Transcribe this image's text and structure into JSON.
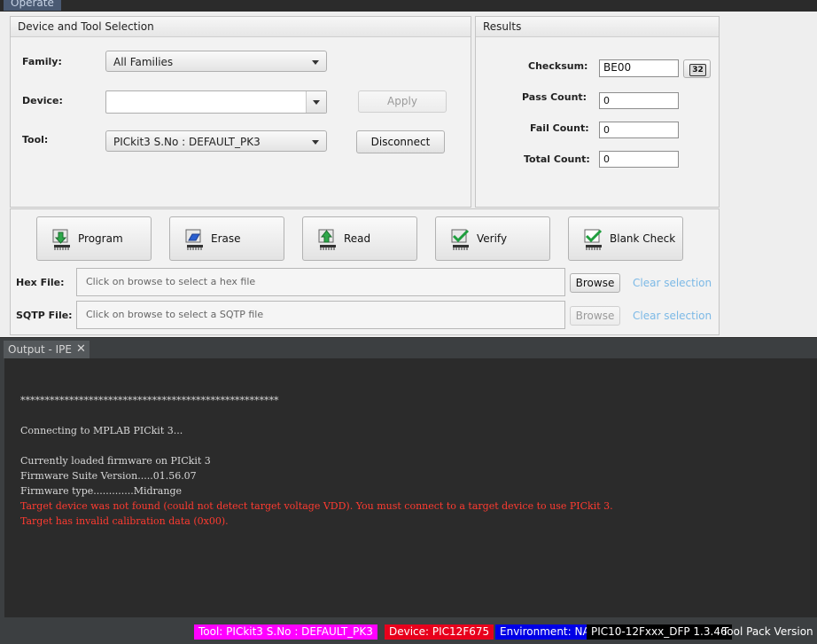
{
  "top": {
    "tab_label": "Operate"
  },
  "device_panel": {
    "title": "Device and Tool Selection",
    "family_label": "Family:",
    "family_value": "All Families",
    "device_label": "Device:",
    "device_value": "",
    "tool_label": "Tool:",
    "tool_value": "PICkit3 S.No : DEFAULT_PK3",
    "apply_label": "Apply",
    "disconnect_label": "Disconnect"
  },
  "results": {
    "title": "Results",
    "checksum_label": "Checksum:",
    "checksum_value": "BE00",
    "checksum_bits": "32",
    "pass_label": "Pass Count:",
    "pass_value": "0",
    "fail_label": "Fail Count:",
    "fail_value": "0",
    "total_label": "Total Count:",
    "total_value": "0"
  },
  "actions": {
    "program": "Program",
    "erase": "Erase",
    "read": "Read",
    "verify": "Verify",
    "blank_check": "Blank Check"
  },
  "files": {
    "hex_label": "Hex File:",
    "hex_placeholder": "Click on browse to select a hex file",
    "sqtp_label": "SQTP File:",
    "sqtp_placeholder": "Click on browse to select a SQTP file",
    "browse": "Browse",
    "clear": "Clear selection"
  },
  "output": {
    "tab_label": "Output - IPE",
    "close_glyph": "✕",
    "lines": [
      "*****************************************************",
      "",
      "Connecting to MPLAB PICkit 3...",
      "",
      "Currently loaded firmware on PICkit 3",
      "Firmware Suite Version.....01.56.07",
      "Firmware type.............Midrange",
      "Target device was not found (could not detect target voltage VDD). You must connect to a target device to use PICkit 3.",
      "Target has invalid calibration data (0x00)."
    ]
  },
  "status": {
    "tool": "Tool: PICkit3 S.No : DEFAULT_PK3",
    "device": "Device: PIC12F675",
    "environment": "Environment: NA",
    "dfp": "PIC10-12Fxxx_DFP 1.3.46",
    "toolpack": "Tool Pack Version: L",
    "colors": {
      "tool": "#ff00ff",
      "device": "#e8001c",
      "environment": "#0000e6",
      "dfp": "#000000"
    }
  }
}
